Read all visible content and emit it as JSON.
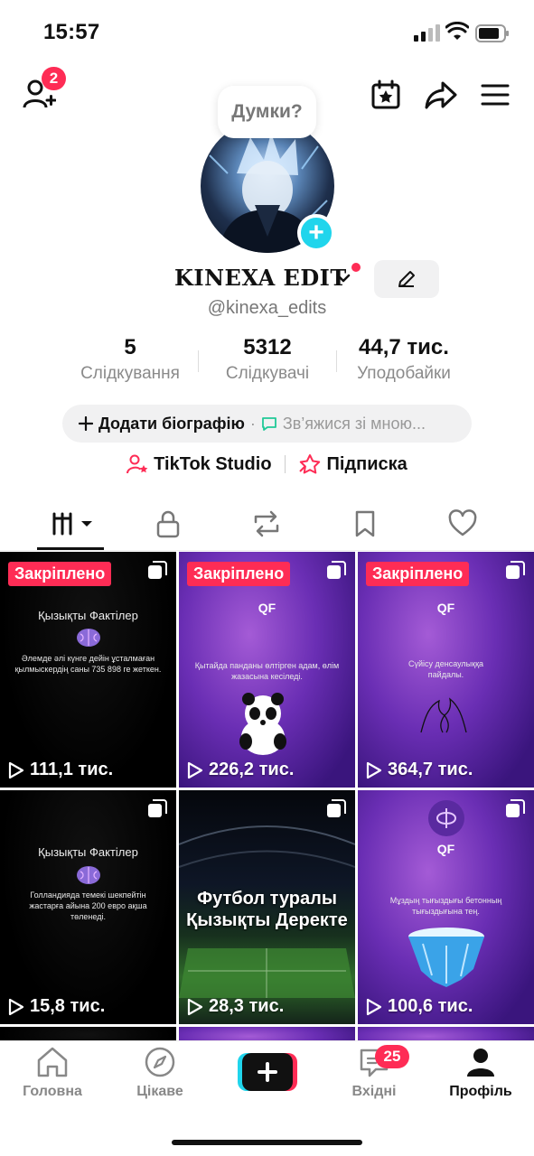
{
  "status_bar": {
    "time": "15:57"
  },
  "top_bar": {
    "friend_requests_count": "2"
  },
  "profile": {
    "thought_bubble": "Думки?",
    "display_name": "KINEXA EDIT",
    "username": "@kinexa_edits"
  },
  "stats": [
    {
      "value": "5",
      "label": "Слідкування"
    },
    {
      "value": "5312",
      "label": "Слідкувачі"
    },
    {
      "value": "44,7 тис.",
      "label": "Уподобайки"
    }
  ],
  "bio": {
    "add_label": "Додати біографію",
    "separator": "·",
    "contact_label": "Зв’яжися зі мною..."
  },
  "links": {
    "studio_label": "TikTok Studio",
    "subscription_label": "Підписка"
  },
  "videos": [
    {
      "pinned": "Закріплено",
      "views": "111,1 тис.",
      "title": "Қызықты Фактілер",
      "text": "Әлемде әлі күнге дейін ұсталмаған қылмыскердің саны 735 898 ге жеткен."
    },
    {
      "pinned": "Закріплено",
      "views": "226,2 тис.",
      "logo": "QF",
      "text": "Қытайда панданы өлтірген адам, өлім жазасына кесіледі."
    },
    {
      "pinned": "Закріплено",
      "views": "364,7 тис.",
      "logo": "QF",
      "text": "Сүйісу денсаулыққа пайдалы."
    },
    {
      "views": "15,8 тис.",
      "title": "Қызықты Фактілер",
      "text": "Голландияда темекі шекпейтін жастарға айына 200 евро ақша төленеді."
    },
    {
      "views": "28,3 тис.",
      "headline_1": "Футбол туралы",
      "headline_2": "Қызықты Деректе"
    },
    {
      "views": "100,6 тис.",
      "logo": "QF",
      "text": "Мұздың тығыздығы бетонның тығыздығына тең."
    }
  ],
  "bottom_nav": {
    "home": "Головна",
    "discover": "Цікаве",
    "inbox": "Вхідні",
    "inbox_badge": "25",
    "profile": "Профіль"
  },
  "colors": {
    "accent": "#fe2c55",
    "cyan": "#20d5ec",
    "text": "#111111",
    "muted": "#8a8a8a"
  }
}
